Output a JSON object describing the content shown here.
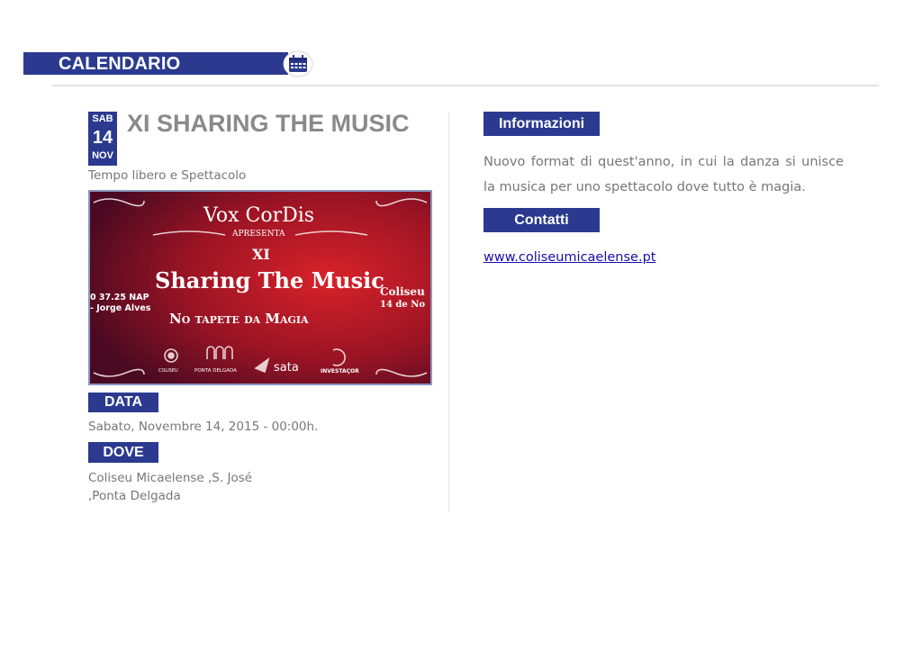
{
  "header": {
    "title": "CALENDARIO",
    "icon": "calendar-icon",
    "accent": "#2b3a8f"
  },
  "event": {
    "day_of_week": "SAB",
    "day": "14",
    "month": "NOV",
    "title": "XI SHARING THE MUSIC",
    "category": "Tempo libero e Spettacolo"
  },
  "poster": {
    "line1": "Vox CorDis",
    "line2": "APRESENTA",
    "line3": "XI",
    "line4": "Sharing The Music",
    "line5": "No tapete da Magia",
    "left_text1": "0 37.25 NAP",
    "left_text2": "- Jorge Alves",
    "right_text1": "Coliseu",
    "right_text2": "14 de No",
    "sponsors": [
      "COLISEU",
      "PONTA DELGADA",
      "sata",
      "INVESTAÇOR"
    ]
  },
  "data_section": {
    "label": "DATA",
    "value": "Sabato, Novembre 14, 2015 - 00:00h."
  },
  "dove_section": {
    "label": "DOVE",
    "line1": "Coliseu Micaelense ,S. José",
    "line2": ",Ponta Delgada"
  },
  "info_section": {
    "label": "Informazioni",
    "text": "Nuovo format di quest'anno, in cui la danza si unisce la musica per uno spettacolo dove tutto è magia."
  },
  "contact_section": {
    "label": "Contatti",
    "link": "www.coliseumicaelense.pt"
  }
}
